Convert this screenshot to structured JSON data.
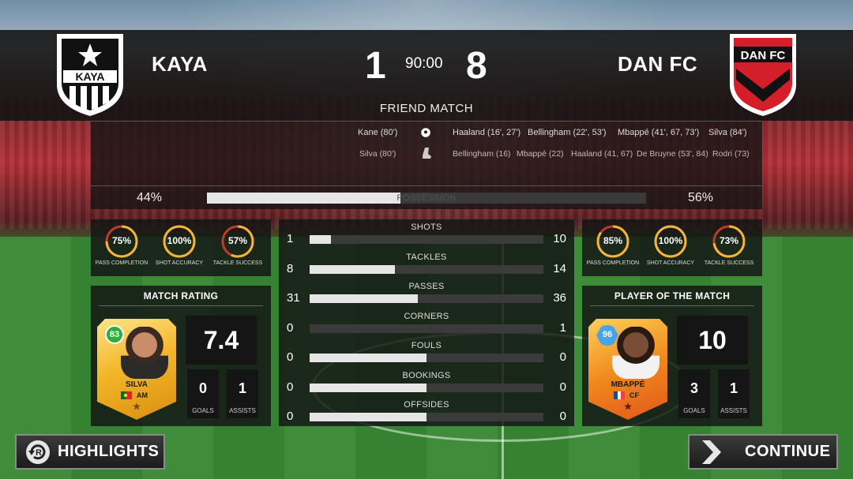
{
  "match": {
    "home_team": "KAYA",
    "away_team": "DAN FC",
    "home_score": "1",
    "away_score": "8",
    "clock": "90:00",
    "type": "FRIEND MATCH"
  },
  "crests": {
    "home_text": "KAYA",
    "away_text": "DAN FC",
    "home_color": "#111111",
    "away_color": "#d41f2a"
  },
  "events": {
    "home_goals": "Kane (80')",
    "away_goals": [
      "Haaland (16', 27')",
      "Bellingham (22', 53')",
      "Mbappé (41', 67, 73')",
      "Silva (84')"
    ],
    "home_assists": "Silva (80')",
    "away_assists": [
      "Bellingham (16)",
      "Mbappé (22)",
      "Haaland (41, 67)",
      "De Bruyne (53', 84)",
      "Rodri (73)"
    ],
    "goal_icon": "football-icon",
    "assist_icon": "boot-icon"
  },
  "possession": {
    "label": "POSSESSION",
    "home": "44%",
    "away": "56%",
    "home_value": 44
  },
  "home_gauges": [
    {
      "value": "75%",
      "pct": 75,
      "label": "PASS COMPLETION"
    },
    {
      "value": "100%",
      "pct": 100,
      "label": "SHOT ACCURACY"
    },
    {
      "value": "57%",
      "pct": 57,
      "label": "TACKLE SUCCESS"
    }
  ],
  "away_gauges": [
    {
      "value": "85%",
      "pct": 85,
      "label": "PASS COMPLETION"
    },
    {
      "value": "100%",
      "pct": 100,
      "label": "SHOT ACCURACY"
    },
    {
      "value": "73%",
      "pct": 73,
      "label": "TACKLE SUCCESS"
    }
  ],
  "stats": [
    {
      "label": "SHOTS",
      "home": "1",
      "away": "10"
    },
    {
      "label": "TACKLES",
      "home": "8",
      "away": "14"
    },
    {
      "label": "PASSES",
      "home": "31",
      "away": "36"
    },
    {
      "label": "CORNERS",
      "home": "0",
      "away": "1"
    },
    {
      "label": "FOULS",
      "home": "0",
      "away": "0"
    },
    {
      "label": "BOOKINGS",
      "home": "0",
      "away": "0"
    },
    {
      "label": "OFFSIDES",
      "home": "0",
      "away": "0"
    }
  ],
  "match_rating": {
    "title": "MATCH RATING",
    "player": "SILVA",
    "overall": "83",
    "position": "AM",
    "rating": "7.4",
    "goals": "0",
    "assists": "1",
    "goals_label": "GOALS",
    "assists_label": "ASSISTS"
  },
  "player_of_match": {
    "title": "PLAYER OF THE MATCH",
    "player": "MBAPPÉ",
    "overall": "96",
    "position": "CF",
    "rating": "10",
    "goals": "3",
    "assists": "1",
    "goals_label": "GOALS",
    "assists_label": "ASSISTS"
  },
  "buttons": {
    "highlights": "HIGHLIGHTS",
    "continue": "CONTINUE"
  }
}
